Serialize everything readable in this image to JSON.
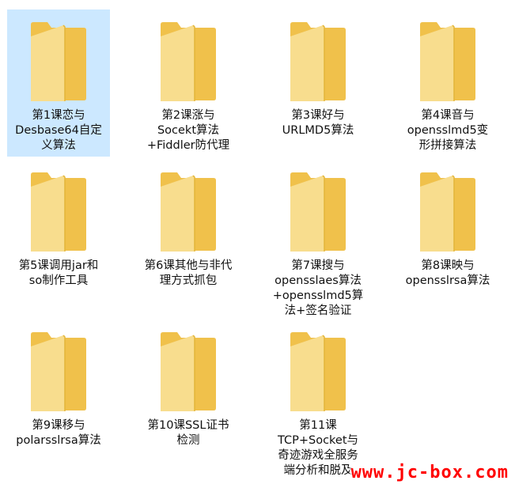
{
  "colors": {
    "selection": "#cce8ff",
    "folder_back": "#f0c14b",
    "folder_front": "#f8dd8e",
    "watermark": "#ff0000"
  },
  "folders": [
    {
      "label": "第1课恋与\nDesbase64自定\n义算法",
      "icon": "folder-icon",
      "selected": true
    },
    {
      "label": "第2课涨与\nSocekt算法\n+Fiddler防代理",
      "icon": "folder-icon",
      "selected": false
    },
    {
      "label": "第3课好与\nURLMD5算法",
      "icon": "folder-icon",
      "selected": false
    },
    {
      "label": "第4课音与\nopensslmd5变\n形拼接算法",
      "icon": "folder-icon",
      "selected": false
    },
    {
      "label": "第5课调用jar和\nso制作工具",
      "icon": "folder-icon",
      "selected": false
    },
    {
      "label": "第6课其他与非代\n理方式抓包",
      "icon": "folder-icon",
      "selected": false
    },
    {
      "label": "第7课搜与\nopensslaes算法\n+opensslmd5算\n法+签名验证",
      "icon": "folder-icon",
      "selected": false
    },
    {
      "label": "第8课映与\nopensslrsa算法",
      "icon": "folder-icon",
      "selected": false
    },
    {
      "label": "第9课移与\npolarsslrsa算法",
      "icon": "folder-icon",
      "selected": false
    },
    {
      "label": "第10课SSL证书\n检测",
      "icon": "folder-icon",
      "selected": false
    },
    {
      "label": "第11课\nTCP+Socket与\n奇迹游戏全服务\n端分析和脱及",
      "icon": "folder-icon",
      "selected": false
    }
  ],
  "watermark": "www.jc-box.com"
}
